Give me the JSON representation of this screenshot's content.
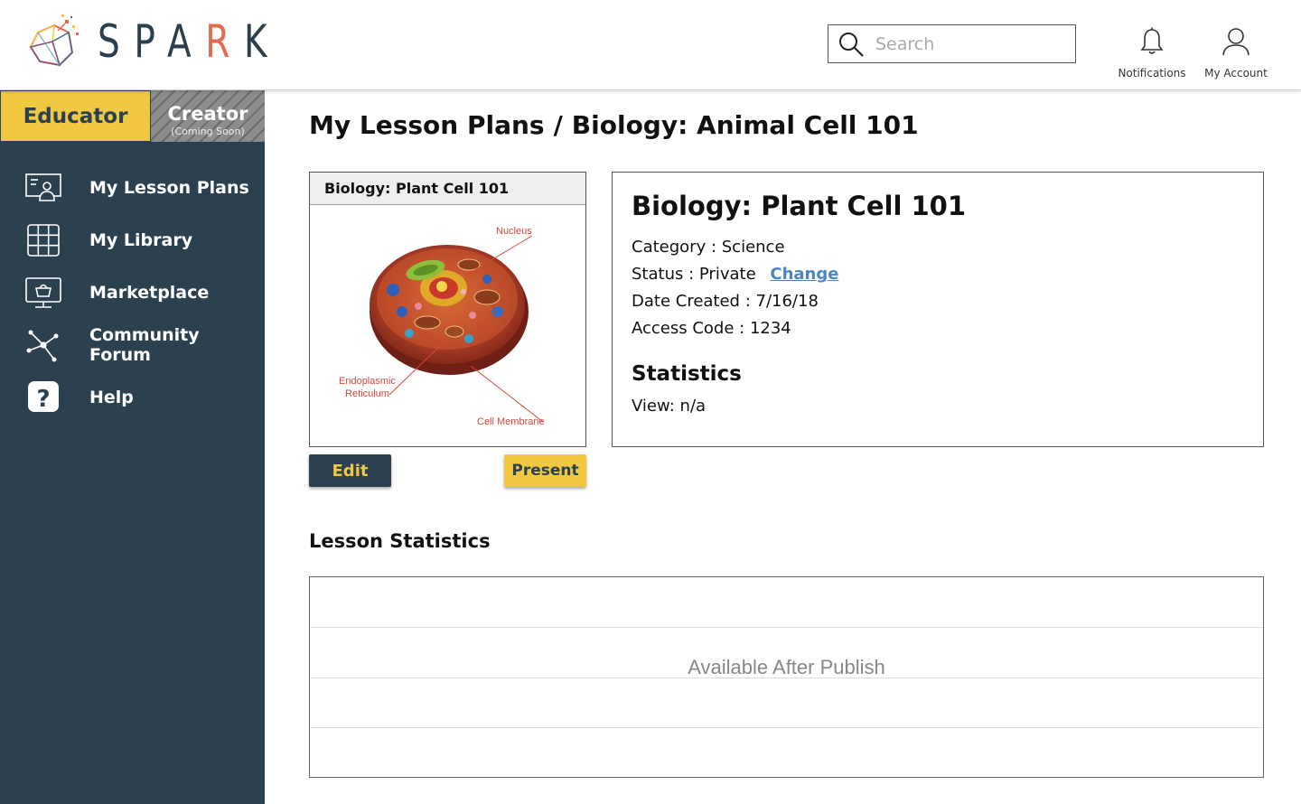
{
  "brand": {
    "name_pre": "SPA",
    "name_accent": "R",
    "name_post": "K",
    "colors": {
      "navy": "#2b4150",
      "accent": "#e46a4d",
      "yellow": "#f1c842",
      "link": "#4a86c7"
    }
  },
  "header": {
    "search_placeholder": "Search",
    "notifications_label": "Notifications",
    "account_label": "My Account"
  },
  "role_tabs": {
    "educator": "Educator",
    "creator": "Creator",
    "creator_note": "(Coming Soon)"
  },
  "sidebar": {
    "items": [
      {
        "label": "My Lesson Plans",
        "icon": "lesson-plans-icon"
      },
      {
        "label": "My Library",
        "icon": "library-grid-icon"
      },
      {
        "label": "Marketplace",
        "icon": "marketplace-icon"
      },
      {
        "label": "Community Forum",
        "icon": "network-icon"
      },
      {
        "label": "Help",
        "icon": "help-icon"
      }
    ]
  },
  "breadcrumb": {
    "root": "My Lesson Plans",
    "separator": "/",
    "current": "Biology: Animal Cell 101"
  },
  "card": {
    "title": "Biology: Plant Cell 101",
    "callouts": {
      "nucleus": "Nucleus",
      "er_line1": "Endoplasmic",
      "er_line2": "Reticulum",
      "membrane": "Cell Membrane"
    },
    "edit_label": "Edit",
    "present_label": "Present"
  },
  "info": {
    "title": "Biology: Plant Cell 101",
    "category_label": "Category :",
    "category": "Science",
    "status_label": "Status :",
    "status": "Private",
    "change_link": "Change",
    "date_label": "Date Created :",
    "date": "7/16/18",
    "code_label": "Access Code :",
    "code": "1234",
    "stats_heading": "Statistics",
    "view_label": "View:",
    "view_value": "n/a"
  },
  "lesson_stats": {
    "heading": "Lesson Statistics",
    "message": "Available After Publish"
  }
}
